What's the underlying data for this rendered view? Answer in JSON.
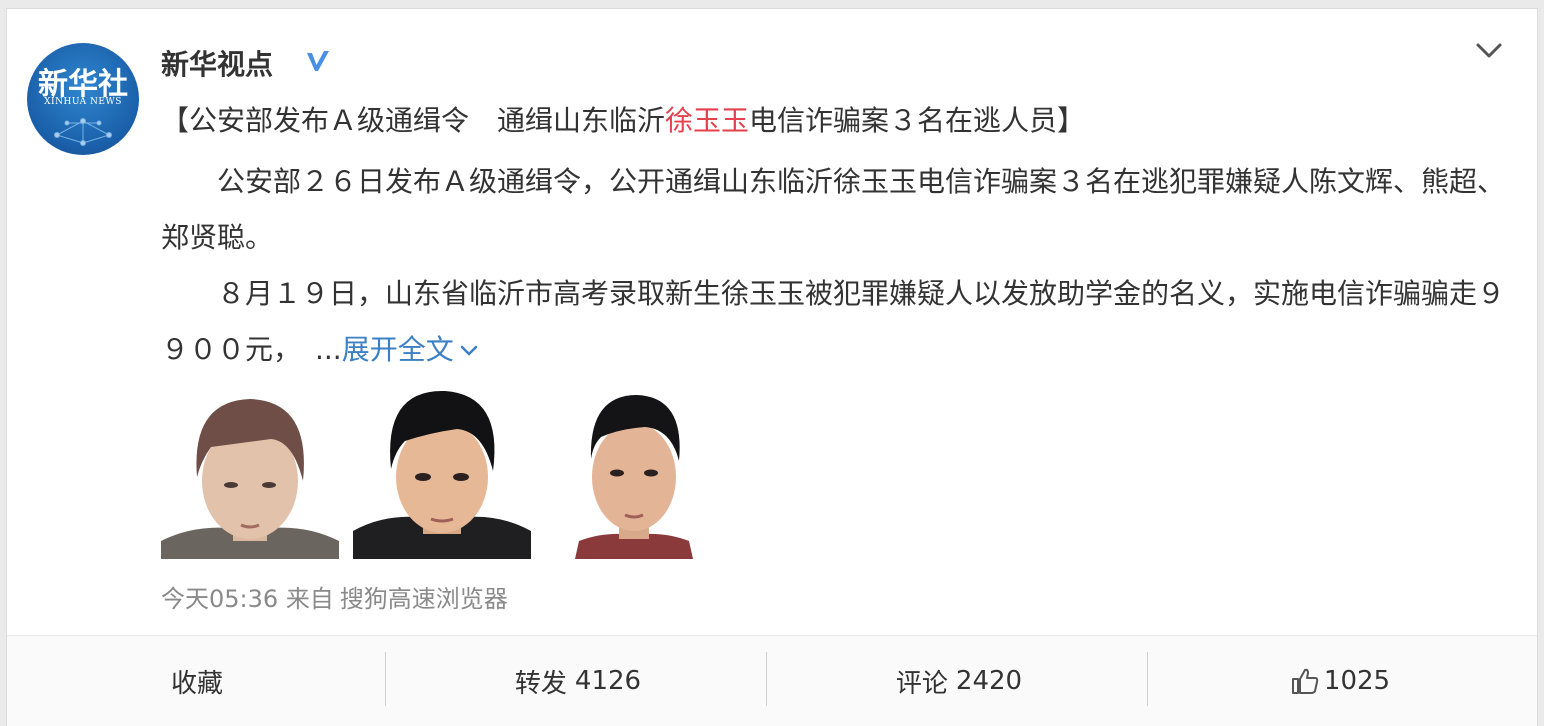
{
  "post": {
    "author": "新华视点",
    "avatar": {
      "logo_cn": "新华社",
      "logo_en": "XINHUA NEWS"
    },
    "title": {
      "before": "【公安部发布Ａ级通缉令　通缉山东临沂",
      "highlight": "徐玉玉",
      "after": "电信诈骗案３名在逃人员】"
    },
    "paragraph1": "　　公安部２６日发布Ａ级通缉令，公开通缉山东临沂徐玉玉电信诈骗案３名在逃犯罪嫌疑人陈文辉、熊超、郑贤聪。",
    "paragraph2": "　　８月１９日，山东省临沂市高考录取新生徐玉玉被犯罪嫌疑人以发放助学金的名义，实施电信诈骗骗走９９００元，　...",
    "expand_label": "展开全文",
    "time": "今天05:36",
    "from_label": "来自",
    "source": "搜狗高速浏览器"
  },
  "actions": {
    "favorite": "收藏",
    "repost_label": "转发",
    "repost_count": "4126",
    "comment_label": "评论",
    "comment_count": "2420",
    "like_count": "1025"
  },
  "colors": {
    "highlight": "#e5414d",
    "link": "#3b7fc4",
    "verified": "#4a90e2",
    "avatar": "#1a5ea8"
  },
  "icons": [
    "verified-icon",
    "chevron-down-icon",
    "thumbs-up-icon"
  ]
}
